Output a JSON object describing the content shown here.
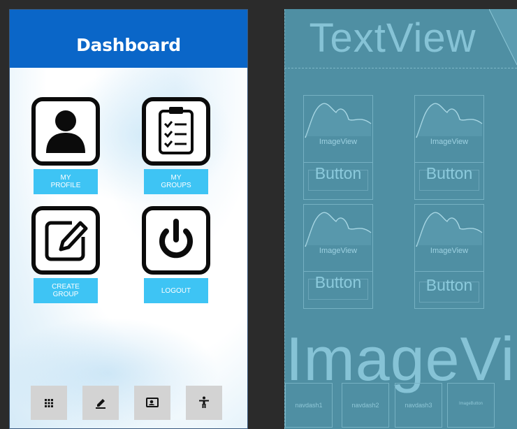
{
  "design": {
    "title": "Dashboard",
    "tiles": [
      {
        "icon": "person-icon",
        "label": "MY\nPROFILE"
      },
      {
        "icon": "clipboard-checklist-icon",
        "label": "MY\nGROUPS"
      },
      {
        "icon": "edit-square-icon",
        "label": "CREATE\nGROUP"
      },
      {
        "icon": "power-icon",
        "label": "LOGOUT"
      }
    ],
    "bottom_nav": [
      {
        "icon": "grid-dots-icon"
      },
      {
        "icon": "pencil-icon"
      },
      {
        "icon": "contact-card-icon"
      },
      {
        "icon": "accessibility-icon"
      }
    ]
  },
  "blueprint": {
    "title": "TextView",
    "image_label": "ImageView",
    "button_label": "Button",
    "big_label": "ImageView",
    "nav": [
      "navdash1",
      "navdash2",
      "navdash3",
      "ImageButton"
    ]
  }
}
